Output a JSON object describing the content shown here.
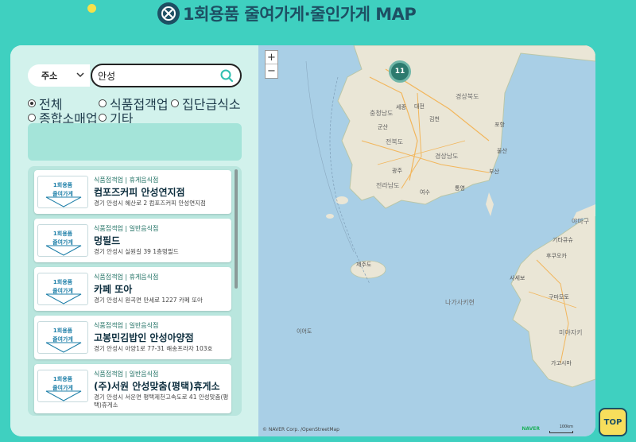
{
  "header": {
    "title": "1회용품 줄여가게·줄인가게 MAP"
  },
  "filter": {
    "select_value": "주소",
    "search_value": "안성",
    "radios": [
      {
        "label": "전체",
        "checked": true
      },
      {
        "label": "식품접객업",
        "checked": false
      },
      {
        "label": "집단급식소",
        "checked": false
      },
      {
        "label": "종합소매업",
        "checked": false
      },
      {
        "label": "기타",
        "checked": false
      }
    ]
  },
  "results": {
    "thumb_line1": "1회용품",
    "thumb_line2": "줄여가게",
    "items": [
      {
        "category": "식품접객업 | 휴게음식점",
        "name": "컴포즈커피 안성연지점",
        "address": "경기 안성시 혜산로 2 컴포즈커피 안성연지점"
      },
      {
        "category": "식품접객업 | 일반음식점",
        "name": "멍필드",
        "address": "경기 안성시 실원길 39 1층멍필드"
      },
      {
        "category": "식품접객업 | 휴게음식점",
        "name": "카페 또아",
        "address": "경기 안성시 원곡면 만세로 1227 카페 또아"
      },
      {
        "category": "식품접객업 | 일반음식점",
        "name": "고봉민김밥인 안성아양점",
        "address": "경기 안성시 아양1로 77-31 해송프라자 103호"
      },
      {
        "category": "식품접객업 | 일반음식점",
        "name": "(주)서원 안성맞춤(평택)휴게소",
        "address": "경기 안성시 서운면 평택제천고속도로 41 안성맞춤(평택)휴게소"
      }
    ]
  },
  "map": {
    "zoom_in": "+",
    "zoom_out": "−",
    "cluster_count": "11",
    "labels": {
      "gyeongbuk": "경상북도",
      "chungnam": "충청남도",
      "sejong": "세종",
      "daejeon": "대전",
      "jeonbuk": "전북도",
      "gunsan": "군산",
      "gimcheon": "김천",
      "pohang": "포항",
      "ulsan": "울산",
      "gyeongnam": "경상남도",
      "busan": "부산",
      "gwangju": "광주",
      "jeonnam": "전라남도",
      "yeosu": "여수",
      "tongyeong": "통영",
      "jejudo": "제주도",
      "kitakyushu": "기타큐슈",
      "fukuoka": "후쿠오카",
      "saseho": "사세보",
      "kumamoto": "구마모토",
      "nagasaki": "나가사키현",
      "miyazaki": "미야자키",
      "yamaguchi": "야마구",
      "kagoshima": "가고시마",
      "iyeodo": "이어도"
    },
    "copyright": "© NAVER Corp. /OpenStreetMap",
    "naver": "NAVER",
    "scale": "100km"
  },
  "top_button": "TOP",
  "colors": {
    "background": "#3fd0c0",
    "accent": "#1d4f63",
    "top_button": "#f7de5c"
  }
}
